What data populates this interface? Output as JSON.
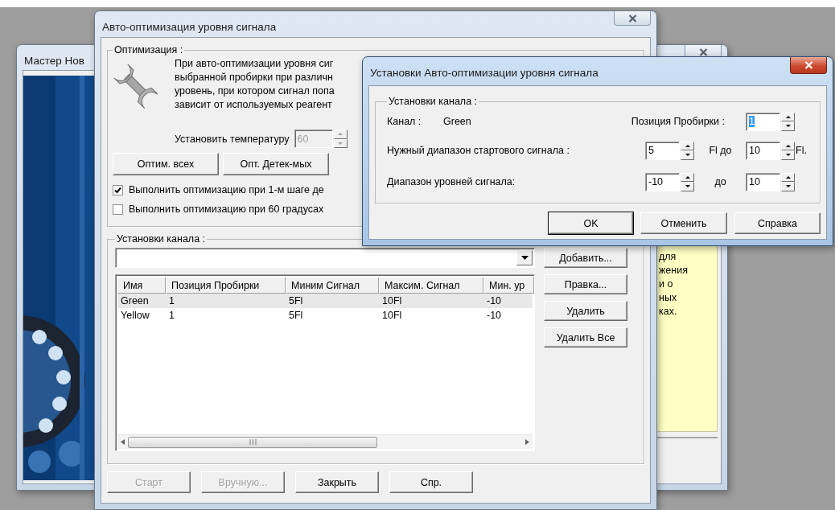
{
  "windows": [
    {
      "kind": "wizard",
      "title": "Мастер Нов",
      "active": false,
      "note_lines": [
        "для",
        "жения",
        "и о",
        "ных",
        "ках."
      ]
    },
    {
      "kind": "optimization",
      "title": "Авто-оптимизация уровня сигнала",
      "active": false,
      "optimization": {
        "label": "Оптимизация :",
        "description": [
          "При авто-оптимизации уровня сиг",
          "выбранной пробирки при различн",
          "уровень, при котором сигнал попа",
          "зависит от используемых реагент"
        ],
        "temperature_label": "Установить температуру",
        "temperature": {
          "value": "60",
          "disabled": true
        },
        "buttons": [
          "Оптим. всех",
          "Опт. Детек-мых"
        ],
        "options": [
          {
            "label": "Выполнить оптимизацию при 1-м шаге де",
            "checked": true
          },
          {
            "label": "Выполнить оптимизацию при 60 градусах",
            "checked": false
          }
        ]
      },
      "channels": {
        "label": "Установки канала :",
        "columns": [
          "Имя",
          "Позиция Пробирки",
          "Миним Сигнал",
          "Максим. Сигнал",
          "Мин. ур"
        ],
        "rows": [
          {
            "cells": [
              "Green",
              "1",
              "5Fl",
              "10Fl",
              "-10"
            ],
            "selected": true
          },
          {
            "cells": [
              "Yellow",
              "1",
              "5Fl",
              "10Fl",
              "-10"
            ],
            "selected": false
          }
        ],
        "buttons": [
          "Добавить...",
          "Правка...",
          "Удалить",
          "Удалить Все"
        ]
      },
      "footer_buttons": [
        {
          "label": "Старт",
          "disabled": true
        },
        {
          "label": "Вручную...",
          "disabled": true
        },
        {
          "label": "Закрыть",
          "disabled": false
        },
        {
          "label": "Спр.",
          "disabled": false
        }
      ]
    },
    {
      "kind": "settings",
      "title": "Установки Авто-оптимизации уровня сигнала",
      "active": true,
      "group_label": "Установки канала :",
      "channel_label": "Канал :",
      "channel": "Green",
      "position_label": "Позиция Пробирки :",
      "position": {
        "value": "1",
        "text_selected": true
      },
      "ranges": [
        {
          "label": "Нужный диапазон стартового сигнала :",
          "from": "5",
          "middle": "Fl до",
          "to": "10",
          "suffix": "Fl."
        },
        {
          "label": "Диапазон уровней сигнала:",
          "from": "-10",
          "middle": "до",
          "to": "10"
        }
      ],
      "buttons": [
        {
          "label": "OK",
          "default": true
        },
        {
          "label": "Отменить",
          "default": false
        },
        {
          "label": "Справка",
          "default": false
        }
      ]
    }
  ]
}
